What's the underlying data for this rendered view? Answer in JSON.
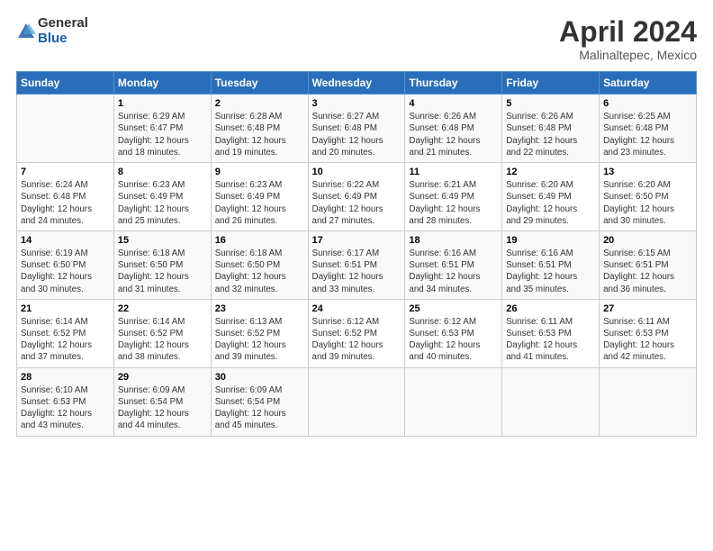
{
  "header": {
    "logo_general": "General",
    "logo_blue": "Blue",
    "title": "April 2024",
    "subtitle": "Malinaltepec, Mexico"
  },
  "days_of_week": [
    "Sunday",
    "Monday",
    "Tuesday",
    "Wednesday",
    "Thursday",
    "Friday",
    "Saturday"
  ],
  "weeks": [
    [
      {
        "day": "",
        "info": ""
      },
      {
        "day": "1",
        "info": "Sunrise: 6:29 AM\nSunset: 6:47 PM\nDaylight: 12 hours\nand 18 minutes."
      },
      {
        "day": "2",
        "info": "Sunrise: 6:28 AM\nSunset: 6:48 PM\nDaylight: 12 hours\nand 19 minutes."
      },
      {
        "day": "3",
        "info": "Sunrise: 6:27 AM\nSunset: 6:48 PM\nDaylight: 12 hours\nand 20 minutes."
      },
      {
        "day": "4",
        "info": "Sunrise: 6:26 AM\nSunset: 6:48 PM\nDaylight: 12 hours\nand 21 minutes."
      },
      {
        "day": "5",
        "info": "Sunrise: 6:26 AM\nSunset: 6:48 PM\nDaylight: 12 hours\nand 22 minutes."
      },
      {
        "day": "6",
        "info": "Sunrise: 6:25 AM\nSunset: 6:48 PM\nDaylight: 12 hours\nand 23 minutes."
      }
    ],
    [
      {
        "day": "7",
        "info": "Sunrise: 6:24 AM\nSunset: 6:48 PM\nDaylight: 12 hours\nand 24 minutes."
      },
      {
        "day": "8",
        "info": "Sunrise: 6:23 AM\nSunset: 6:49 PM\nDaylight: 12 hours\nand 25 minutes."
      },
      {
        "day": "9",
        "info": "Sunrise: 6:23 AM\nSunset: 6:49 PM\nDaylight: 12 hours\nand 26 minutes."
      },
      {
        "day": "10",
        "info": "Sunrise: 6:22 AM\nSunset: 6:49 PM\nDaylight: 12 hours\nand 27 minutes."
      },
      {
        "day": "11",
        "info": "Sunrise: 6:21 AM\nSunset: 6:49 PM\nDaylight: 12 hours\nand 28 minutes."
      },
      {
        "day": "12",
        "info": "Sunrise: 6:20 AM\nSunset: 6:49 PM\nDaylight: 12 hours\nand 29 minutes."
      },
      {
        "day": "13",
        "info": "Sunrise: 6:20 AM\nSunset: 6:50 PM\nDaylight: 12 hours\nand 30 minutes."
      }
    ],
    [
      {
        "day": "14",
        "info": "Sunrise: 6:19 AM\nSunset: 6:50 PM\nDaylight: 12 hours\nand 30 minutes."
      },
      {
        "day": "15",
        "info": "Sunrise: 6:18 AM\nSunset: 6:50 PM\nDaylight: 12 hours\nand 31 minutes."
      },
      {
        "day": "16",
        "info": "Sunrise: 6:18 AM\nSunset: 6:50 PM\nDaylight: 12 hours\nand 32 minutes."
      },
      {
        "day": "17",
        "info": "Sunrise: 6:17 AM\nSunset: 6:51 PM\nDaylight: 12 hours\nand 33 minutes."
      },
      {
        "day": "18",
        "info": "Sunrise: 6:16 AM\nSunset: 6:51 PM\nDaylight: 12 hours\nand 34 minutes."
      },
      {
        "day": "19",
        "info": "Sunrise: 6:16 AM\nSunset: 6:51 PM\nDaylight: 12 hours\nand 35 minutes."
      },
      {
        "day": "20",
        "info": "Sunrise: 6:15 AM\nSunset: 6:51 PM\nDaylight: 12 hours\nand 36 minutes."
      }
    ],
    [
      {
        "day": "21",
        "info": "Sunrise: 6:14 AM\nSunset: 6:52 PM\nDaylight: 12 hours\nand 37 minutes."
      },
      {
        "day": "22",
        "info": "Sunrise: 6:14 AM\nSunset: 6:52 PM\nDaylight: 12 hours\nand 38 minutes."
      },
      {
        "day": "23",
        "info": "Sunrise: 6:13 AM\nSunset: 6:52 PM\nDaylight: 12 hours\nand 39 minutes."
      },
      {
        "day": "24",
        "info": "Sunrise: 6:12 AM\nSunset: 6:52 PM\nDaylight: 12 hours\nand 39 minutes."
      },
      {
        "day": "25",
        "info": "Sunrise: 6:12 AM\nSunset: 6:53 PM\nDaylight: 12 hours\nand 40 minutes."
      },
      {
        "day": "26",
        "info": "Sunrise: 6:11 AM\nSunset: 6:53 PM\nDaylight: 12 hours\nand 41 minutes."
      },
      {
        "day": "27",
        "info": "Sunrise: 6:11 AM\nSunset: 6:53 PM\nDaylight: 12 hours\nand 42 minutes."
      }
    ],
    [
      {
        "day": "28",
        "info": "Sunrise: 6:10 AM\nSunset: 6:53 PM\nDaylight: 12 hours\nand 43 minutes."
      },
      {
        "day": "29",
        "info": "Sunrise: 6:09 AM\nSunset: 6:54 PM\nDaylight: 12 hours\nand 44 minutes."
      },
      {
        "day": "30",
        "info": "Sunrise: 6:09 AM\nSunset: 6:54 PM\nDaylight: 12 hours\nand 45 minutes."
      },
      {
        "day": "",
        "info": ""
      },
      {
        "day": "",
        "info": ""
      },
      {
        "day": "",
        "info": ""
      },
      {
        "day": "",
        "info": ""
      }
    ]
  ]
}
